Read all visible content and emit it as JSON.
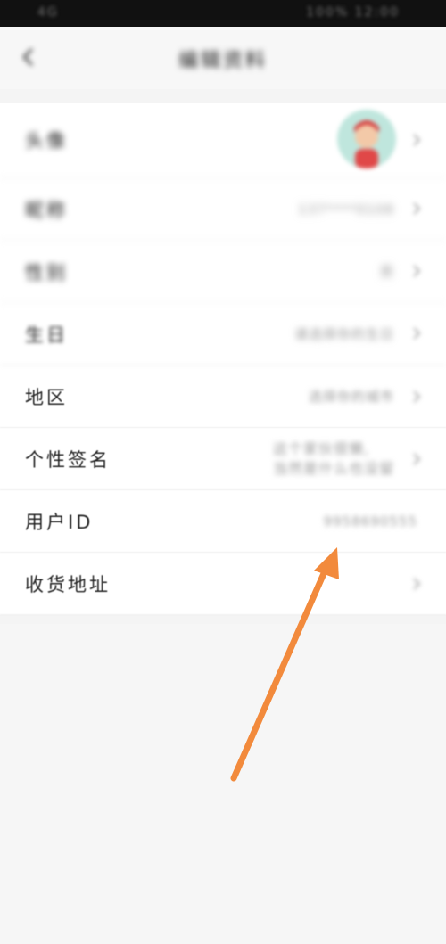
{
  "status_bar": {
    "left_text": "4G",
    "right_text": "100% 12:00"
  },
  "nav": {
    "title": "编辑资料"
  },
  "profile_rows": [
    {
      "key": "avatar",
      "label": "头像"
    },
    {
      "key": "nickname",
      "label": "昵称",
      "value": "137****0108"
    },
    {
      "key": "gender",
      "label": "性别",
      "value": "男"
    },
    {
      "key": "birthday",
      "label": "生日",
      "value": "请选择你的生日"
    },
    {
      "key": "region",
      "label": "地区",
      "value": "选择你的城市"
    },
    {
      "key": "signature",
      "label": "个性签名",
      "value_line1": "这个家伙很懒,",
      "value_line2": "当然是什么也没留"
    },
    {
      "key": "user_id",
      "label": "用户ID",
      "value": "9958690555"
    },
    {
      "key": "address",
      "label": "收货地址"
    }
  ],
  "colors": {
    "accent_arrow": "#f28a3c",
    "avatar_bg": "#bfe6dd"
  }
}
